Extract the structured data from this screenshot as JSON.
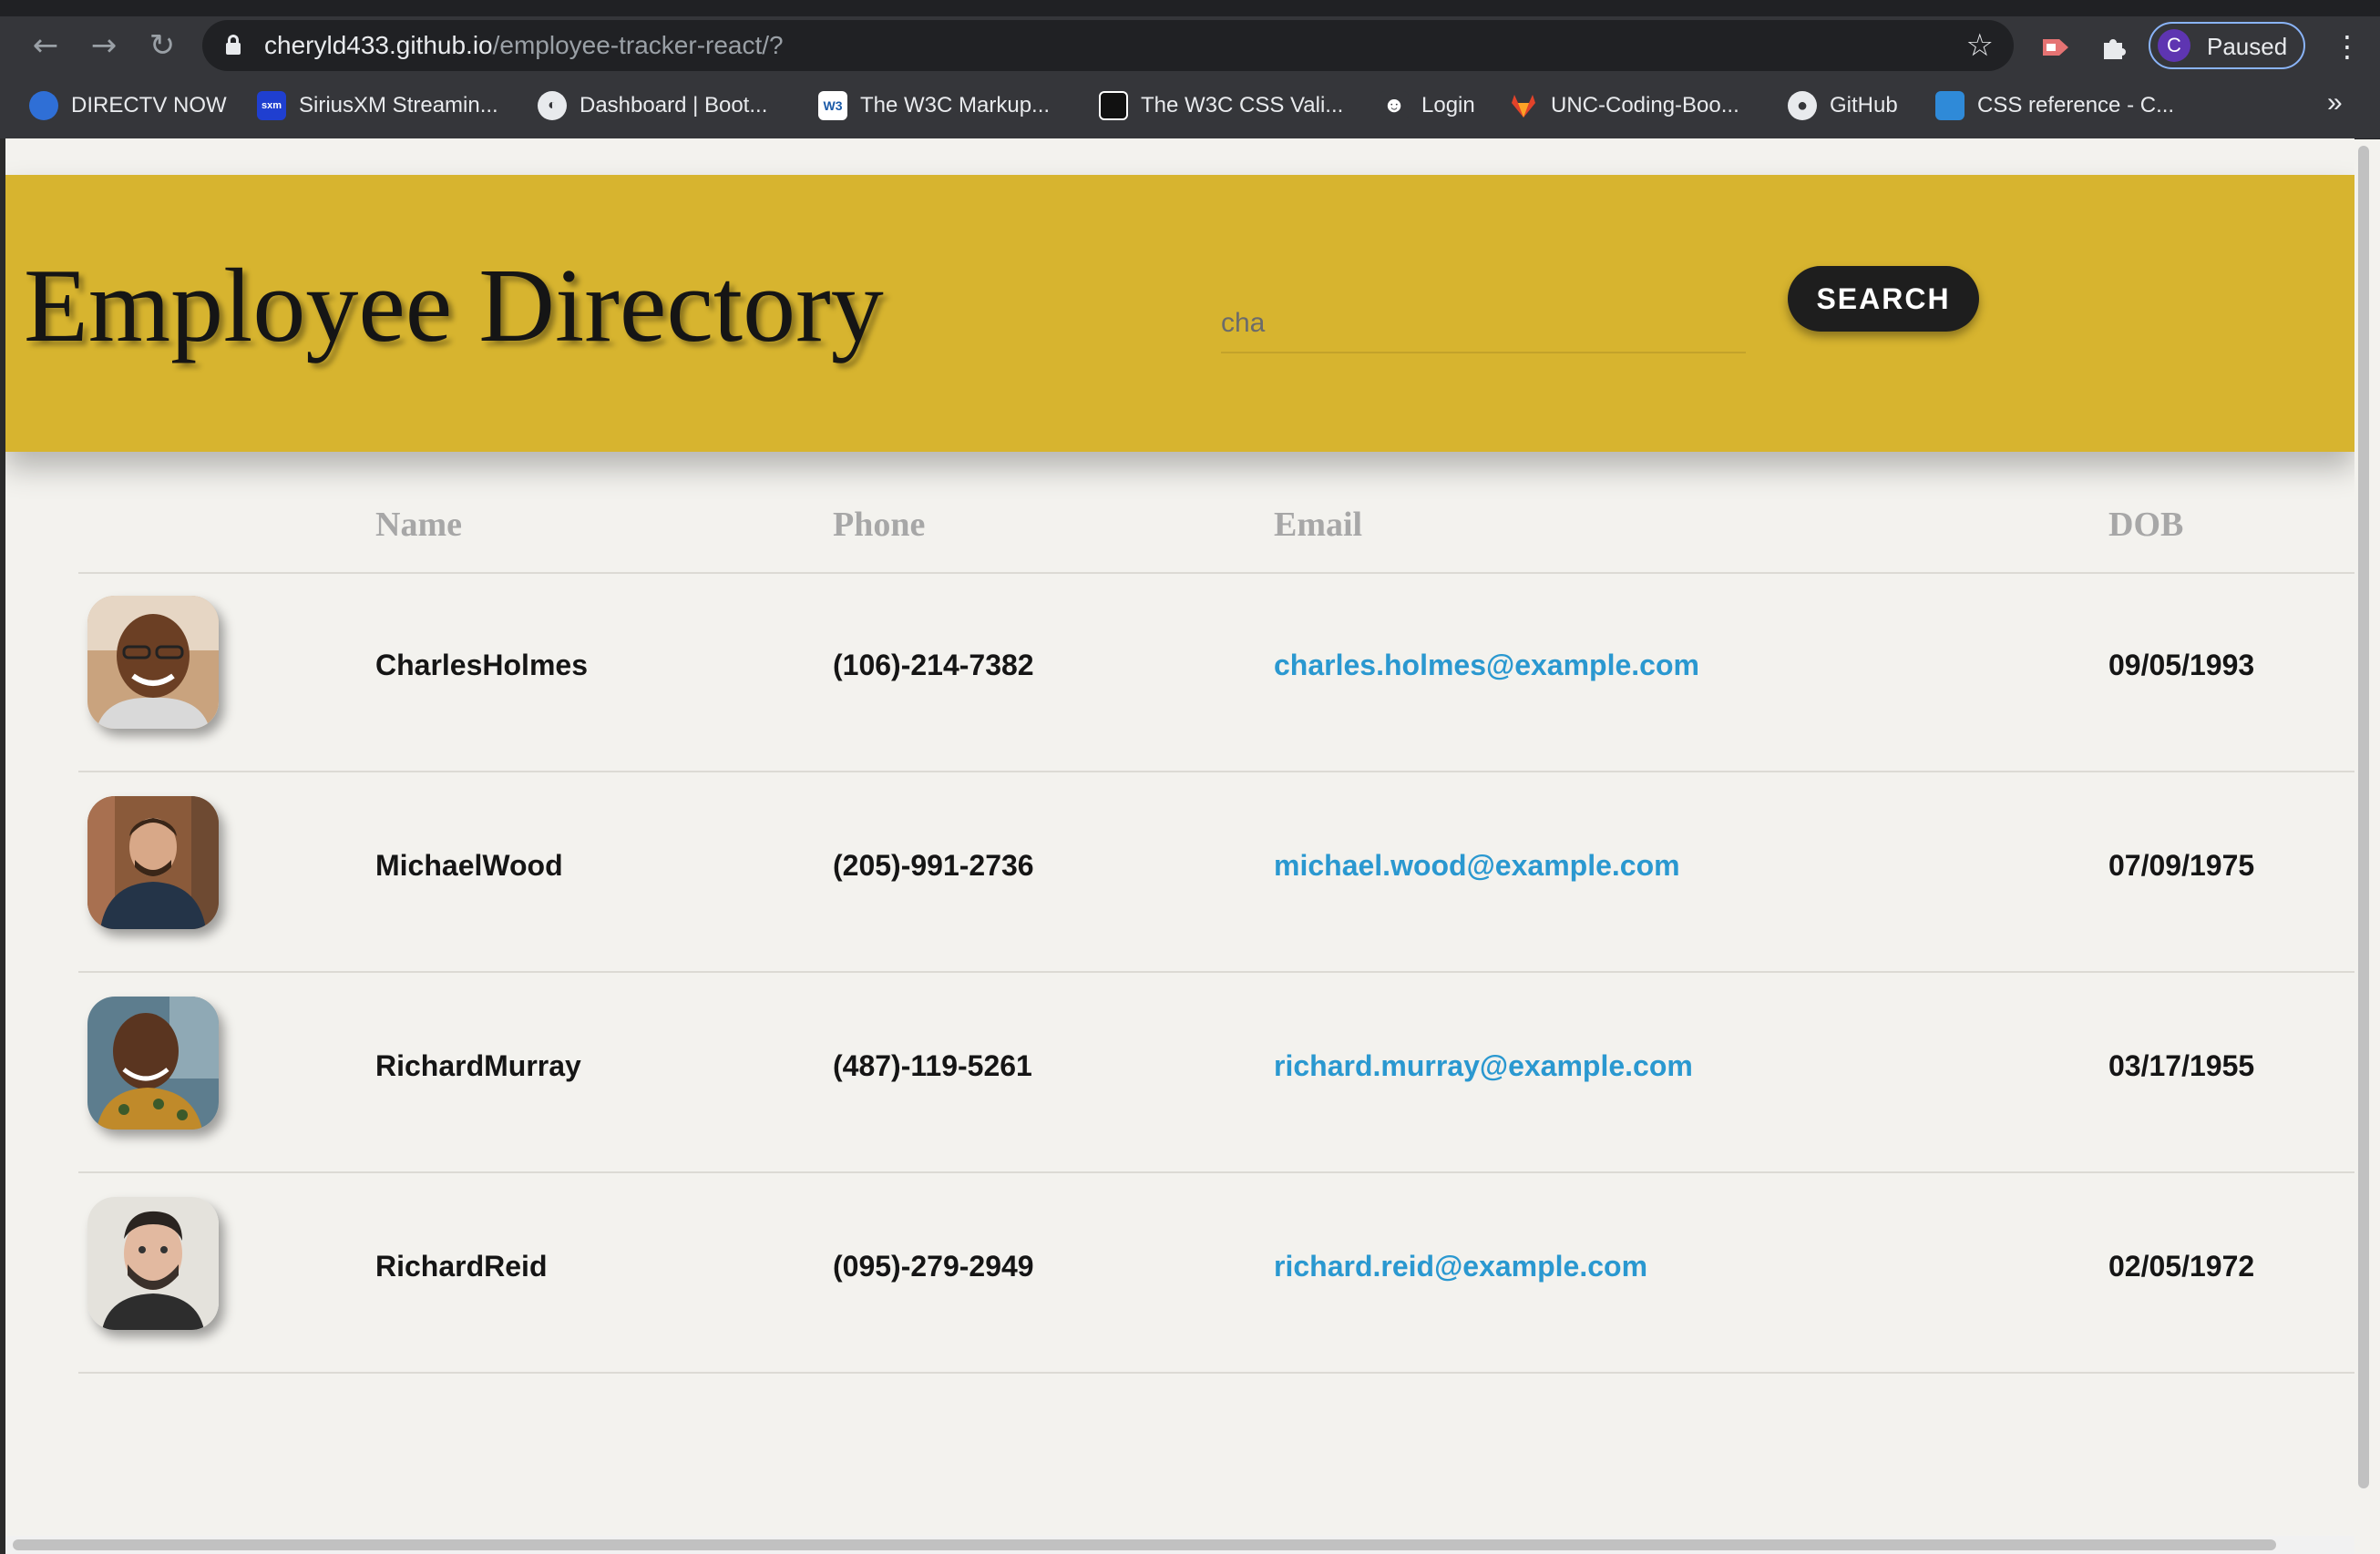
{
  "browser": {
    "url_host": "cheryld433.github.io",
    "url_path": "/employee-tracker-react/?",
    "profile_initial": "C",
    "profile_status": "Paused",
    "bookmarks": [
      {
        "label": "DIRECTV NOW",
        "icon": "directv-globe-icon",
        "color": "#2f6fd6"
      },
      {
        "label": "SiriusXM Streamin...",
        "icon": "siriusxm-icon",
        "color": "#1f3fd0"
      },
      {
        "label": "Dashboard | Boot...",
        "icon": "globe-icon",
        "color": "#5f6368"
      },
      {
        "label": "The W3C Markup...",
        "icon": "w3c-icon",
        "color": "#ffffff"
      },
      {
        "label": "The W3C CSS Vali...",
        "icon": "w3c-css-icon",
        "color": "#111111"
      },
      {
        "label": "Login",
        "icon": "ninja-icon",
        "color": "#35363a"
      },
      {
        "label": "UNC-Coding-Boo...",
        "icon": "gitlab-icon",
        "color": "#e2432a"
      },
      {
        "label": "GitHub",
        "icon": "github-icon",
        "color": "#35363a"
      },
      {
        "label": "CSS reference - C...",
        "icon": "css-reference-icon",
        "color": "#2f8ad8"
      }
    ],
    "more_bookmarks": "»"
  },
  "header": {
    "title": "Employee Directory",
    "search_value": "cha",
    "search_button": "SEARCH",
    "background_color": "#d7b42f"
  },
  "table": {
    "columns": [
      "Name",
      "Phone",
      "Email",
      "DOB"
    ],
    "rows": [
      {
        "name": "CharlesHolmes",
        "phone": "(106)-214-7382",
        "email": "charles.holmes@example.com",
        "dob": "09/05/1993"
      },
      {
        "name": "MichaelWood",
        "phone": "(205)-991-2736",
        "email": "michael.wood@example.com",
        "dob": "07/09/1975"
      },
      {
        "name": "RichardMurray",
        "phone": "(487)-119-5261",
        "email": "richard.murray@example.com",
        "dob": "03/17/1955"
      },
      {
        "name": "RichardReid",
        "phone": "(095)-279-2949",
        "email": "richard.reid@example.com",
        "dob": "02/05/1972"
      }
    ],
    "link_color": "#2a98d0"
  }
}
